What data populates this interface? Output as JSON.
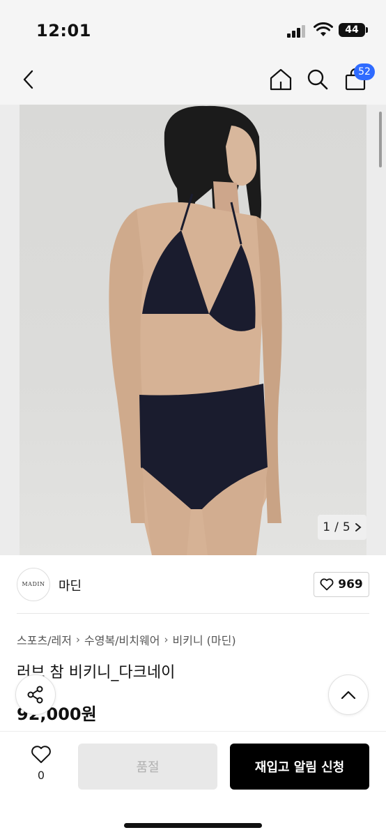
{
  "status_bar": {
    "time": "12:01",
    "battery": "44"
  },
  "nav": {
    "cart_count": "52",
    "icons": [
      "back-chevron-icon",
      "home-icon",
      "search-icon",
      "cart-bag-icon"
    ]
  },
  "gallery": {
    "current": "1",
    "separator": "/",
    "total": "5",
    "image_alt": "dark navy bikini product photo"
  },
  "brand": {
    "logo_text": "MADIN",
    "name": "마딘",
    "like_count": "969"
  },
  "breadcrumb": [
    "스포츠/레저",
    "수영복/비치웨어",
    "비키니 (마딘)"
  ],
  "product": {
    "title": "러브 참 비키니_다크네이",
    "price": "92,000원"
  },
  "bottom": {
    "wish_count": "0",
    "soldout_label": "품절",
    "restock_label": "재입고 알림 신청"
  },
  "colors": {
    "accent": "#2f6bff",
    "primary_button": "#000000",
    "disabled_button": "#e8e8e8",
    "swimsuit": "#1a1c2e"
  }
}
